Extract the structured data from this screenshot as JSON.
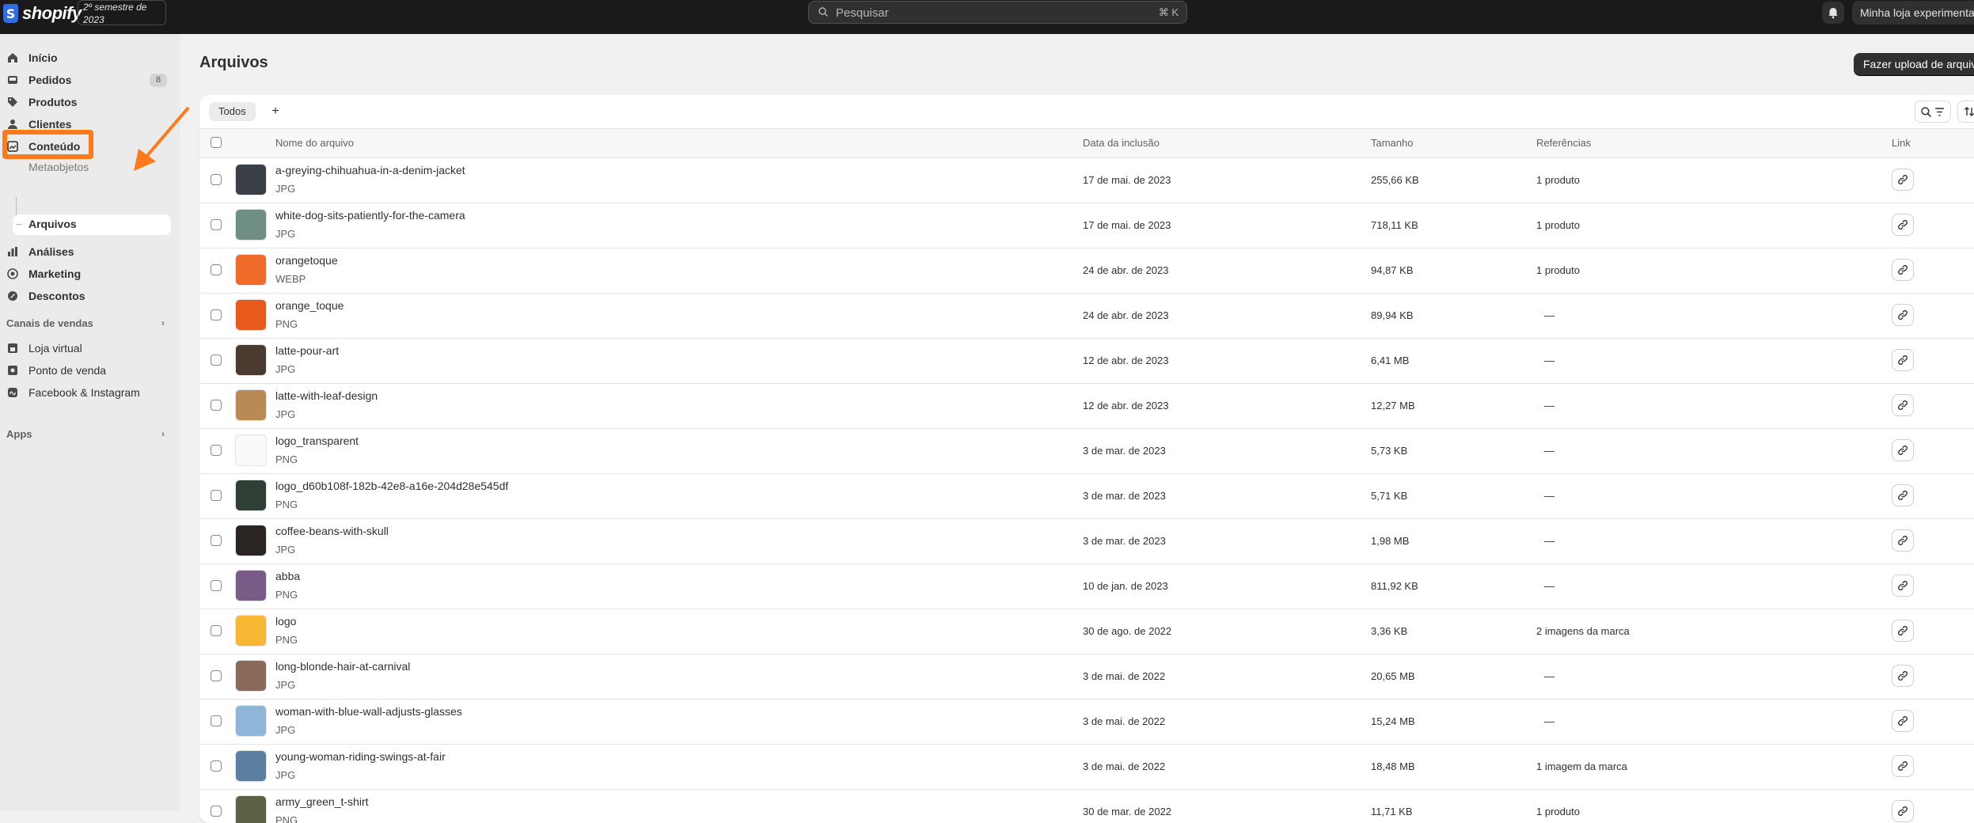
{
  "topbar": {
    "brand": "shopify",
    "semester_badge": "2º semestre de 2023",
    "search_placeholder": "Pesquisar",
    "search_shortcut": "⌘ K",
    "store_name": "Minha loja experimental"
  },
  "sidebar": {
    "items": [
      {
        "label": "Início",
        "icon": "home-icon"
      },
      {
        "label": "Pedidos",
        "icon": "inbox-icon",
        "badge": "8"
      },
      {
        "label": "Produtos",
        "icon": "tag-icon"
      },
      {
        "label": "Clientes",
        "icon": "person-icon"
      },
      {
        "label": "Conteúdo",
        "icon": "content-icon"
      }
    ],
    "content_sub": [
      "Metaobjetos",
      "Arquivos"
    ],
    "items2": [
      {
        "label": "Análises",
        "icon": "bar-chart-icon"
      },
      {
        "label": "Marketing",
        "icon": "target-icon"
      },
      {
        "label": "Descontos",
        "icon": "discount-icon"
      }
    ],
    "sales_section": "Canais de vendas",
    "sales_items": [
      {
        "label": "Loja virtual",
        "icon": "store-icon"
      },
      {
        "label": "Ponto de venda",
        "icon": "pos-icon"
      },
      {
        "label": "Facebook & Instagram",
        "icon": "meta-icon"
      }
    ],
    "apps_section": "Apps"
  },
  "page": {
    "title": "Arquivos",
    "upload_button": "Fazer upload de arquivos"
  },
  "tabs": {
    "all": "Todos",
    "add": "+"
  },
  "table": {
    "headers": {
      "name": "Nome do arquivo",
      "date": "Data da inclusão",
      "size": "Tamanho",
      "refs": "Referências",
      "link": "Link"
    },
    "rows": [
      {
        "name": "a-greying-chihuahua-in-a-denim-jacket",
        "type": "JPG",
        "date": "17 de mai. de 2023",
        "size": "255,66 KB",
        "refs": "1 produto",
        "thumb": "#3a3f47"
      },
      {
        "name": "white-dog-sits-patiently-for-the-camera",
        "type": "JPG",
        "date": "17 de mai. de 2023",
        "size": "718,11 KB",
        "refs": "1 produto",
        "thumb": "#6f8f86"
      },
      {
        "name": "orangetoque",
        "type": "WEBP",
        "date": "24 de abr. de 2023",
        "size": "94,87 KB",
        "refs": "1 produto",
        "thumb": "#f06a2a"
      },
      {
        "name": "orange_toque",
        "type": "PNG",
        "date": "24 de abr. de 2023",
        "size": "89,94 KB",
        "refs": "—",
        "thumb": "#e85a1c"
      },
      {
        "name": "latte-pour-art",
        "type": "JPG",
        "date": "12 de abr. de 2023",
        "size": "6,41 MB",
        "refs": "—",
        "thumb": "#4a3a30"
      },
      {
        "name": "latte-with-leaf-design",
        "type": "JPG",
        "date": "12 de abr. de 2023",
        "size": "12,27 MB",
        "refs": "—",
        "thumb": "#b98a55"
      },
      {
        "name": "logo_transparent",
        "type": "PNG",
        "date": "3 de mar. de 2023",
        "size": "5,73 KB",
        "refs": "—",
        "thumb": "#fafafa"
      },
      {
        "name": "logo_d60b108f-182b-42e8-a16e-204d28e545df",
        "type": "PNG",
        "date": "3 de mar. de 2023",
        "size": "5,71 KB",
        "refs": "—",
        "thumb": "#2f3f36"
      },
      {
        "name": "coffee-beans-with-skull",
        "type": "JPG",
        "date": "3 de mar. de 2023",
        "size": "1,98 MB",
        "refs": "—",
        "thumb": "#2a2522"
      },
      {
        "name": "abba",
        "type": "PNG",
        "date": "10 de jan. de 2023",
        "size": "811,92 KB",
        "refs": "—",
        "thumb": "#7a5a86"
      },
      {
        "name": "logo",
        "type": "PNG",
        "date": "30 de ago. de 2022",
        "size": "3,36 KB",
        "refs": "2 imagens da marca",
        "thumb": "#f7b733"
      },
      {
        "name": "long-blonde-hair-at-carnival",
        "type": "JPG",
        "date": "3 de mai. de 2022",
        "size": "20,65 MB",
        "refs": "—",
        "thumb": "#8a6a5a"
      },
      {
        "name": "woman-with-blue-wall-adjusts-glasses",
        "type": "JPG",
        "date": "3 de mai. de 2022",
        "size": "15,24 MB",
        "refs": "—",
        "thumb": "#8fb5d8"
      },
      {
        "name": "young-woman-riding-swings-at-fair",
        "type": "JPG",
        "date": "3 de mai. de 2022",
        "size": "18,48 MB",
        "refs": "1 imagem da marca",
        "thumb": "#5a7fa0"
      },
      {
        "name": "army_green_t-shirt",
        "type": "PNG",
        "date": "30 de mar. de 2022",
        "size": "11,71 KB",
        "refs": "1 produto",
        "thumb": "#5b6244"
      }
    ]
  },
  "colors": {
    "accent_annotation": "#ff7a1a",
    "dark": "#1a1a1a"
  }
}
